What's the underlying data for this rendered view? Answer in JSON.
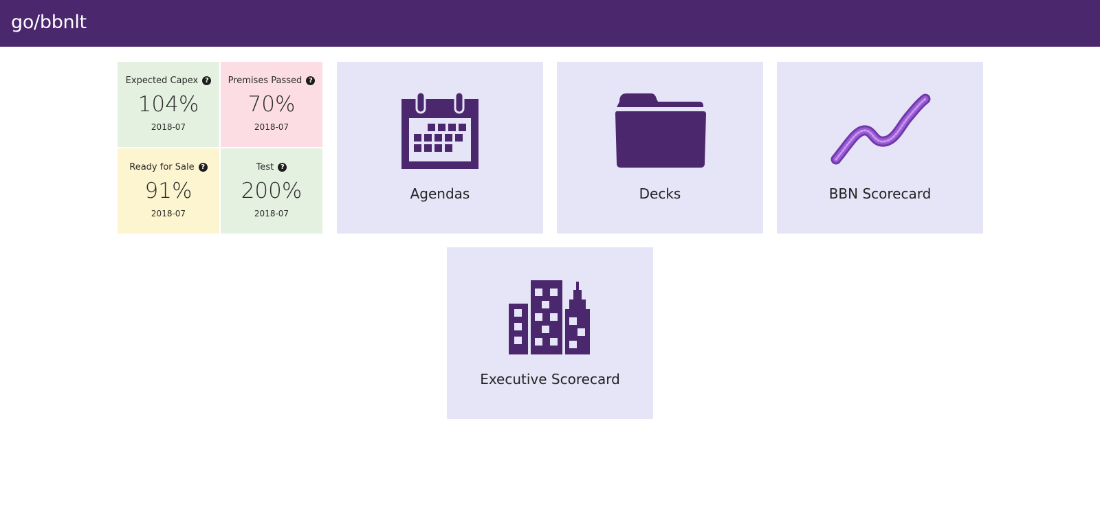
{
  "header": {
    "title": "go/bbnlt"
  },
  "metrics": [
    {
      "label": "Expected Capex",
      "value": "104%",
      "date": "2018-07",
      "color": "#e4f0e0"
    },
    {
      "label": "Premises Passed",
      "value": "70%",
      "date": "2018-07",
      "color": "#fcdde3"
    },
    {
      "label": "Ready for Sale",
      "value": "91%",
      "date": "2018-07",
      "color": "#fdf5cf"
    },
    {
      "label": "Test",
      "value": "200%",
      "date": "2018-07",
      "color": "#e4f0e0"
    }
  ],
  "help_glyph": "?",
  "tiles": [
    {
      "label": "Agendas",
      "icon": "calendar-icon"
    },
    {
      "label": "Decks",
      "icon": "folder-icon"
    },
    {
      "label": "BBN Scorecard",
      "icon": "trend-line-icon"
    },
    {
      "label": "Executive Scorecard",
      "icon": "buildings-icon"
    }
  ],
  "colors": {
    "brand": "#4b276d",
    "tile_bg": "#e6e5f8",
    "trend_accent": "#9b59d6"
  }
}
